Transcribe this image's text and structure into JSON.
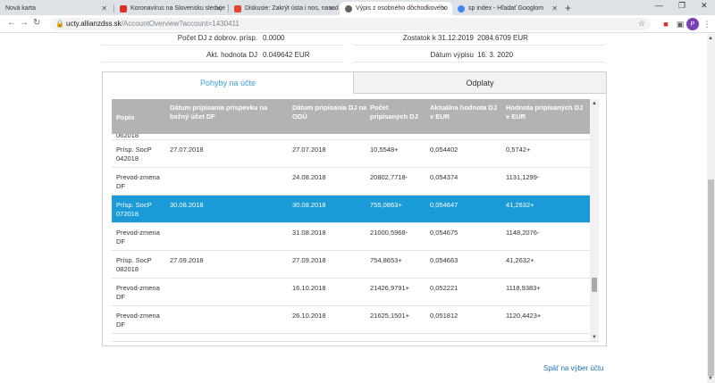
{
  "browser": {
    "tabs": [
      {
        "title": "Nová karta",
        "favicon_color": "#9aa0a6"
      },
      {
        "title": "Koronavírus na Slovensku sleduje",
        "favicon_color": "#d93025"
      },
      {
        "title": "Diskusie: Zakrýt ústa i nos, nasad",
        "favicon_color": "#e0472f"
      },
      {
        "title": "Výpis z osobného dôchodkového",
        "favicon_color": "#5f6368"
      },
      {
        "title": "sp index - Hľadať Googlom",
        "favicon_color": "#4285f4"
      }
    ],
    "active_tab_index": 3,
    "url_host": "ucty.allianzdss.sk",
    "url_path": "/AccountOverview?account=1430411",
    "profile_initial": "P"
  },
  "summary": {
    "left": [
      {
        "label": "Počet DJ z dobrov. prísp.",
        "value": "0.0000"
      },
      {
        "label": "Akt. hodnota DJ",
        "value": "0.049642 EUR"
      }
    ],
    "right": [
      {
        "label": "Zostatok k 31.12.2019",
        "value": "2084.6709 EUR"
      },
      {
        "label": "Dátum výpisu",
        "value": "16. 3. 2020"
      }
    ]
  },
  "tabs": {
    "movements": "Pohyby na účte",
    "payouts": "Odplaty"
  },
  "table": {
    "headers": [
      "Popis",
      "Dátum pripísania príspevku na bežný účet DF",
      "Dátum pripísania DJ na ODÚ",
      "Počet pripísaných DJ",
      "Aktuálna hodnota DJ v EUR",
      "Hodnota pripísaných DJ v EUR"
    ],
    "partial_row": "062018",
    "rows": [
      {
        "popis": "Prísp. SocP 042018",
        "datum_bu": "27.07.2018",
        "datum_odu": "27.07.2018",
        "pocet": "10,5548+",
        "hodnota_dj": "0,054402",
        "hodnota": "0,5742+",
        "selected": false
      },
      {
        "popis": "Prevod-zmena DF",
        "datum_bu": "",
        "datum_odu": "24.08.2018",
        "pocet": "20802,7718-",
        "hodnota_dj": "0,054374",
        "hodnota": "1131,1299-",
        "selected": false
      },
      {
        "popis": "Prísp. SocP 072018",
        "datum_bu": "30.08.2018",
        "datum_odu": "30.08.2018",
        "pocet": "755,0863+",
        "hodnota_dj": "0,054647",
        "hodnota": "41,2632+",
        "selected": true
      },
      {
        "popis": "Prevod-zmena DF",
        "datum_bu": "",
        "datum_odu": "31.08.2018",
        "pocet": "21000,5968-",
        "hodnota_dj": "0,054675",
        "hodnota": "1148,2076-",
        "selected": false
      },
      {
        "popis": "Prísp. SocP 082018",
        "datum_bu": "27.09.2018",
        "datum_odu": "27.09.2018",
        "pocet": "754,8653+",
        "hodnota_dj": "0,054663",
        "hodnota": "41,2632+",
        "selected": false
      },
      {
        "popis": "Prevod-zmena DF",
        "datum_bu": "",
        "datum_odu": "16.10.2018",
        "pocet": "21426,9791+",
        "hodnota_dj": "0,052221",
        "hodnota": "1118,9383+",
        "selected": false
      },
      {
        "popis": "Prevod-zmena DF",
        "datum_bu": "",
        "datum_odu": "26.10.2018",
        "pocet": "21625,1501+",
        "hodnota_dj": "0,051812",
        "hodnota": "1120,4423+",
        "selected": false
      }
    ]
  },
  "back_link": "Späť na výber účtu",
  "colors": {
    "accent": "#3ba0d9",
    "selected_row": "#1a9ad6",
    "header_bg": "#b3b3b3",
    "link": "#1a73b8"
  }
}
